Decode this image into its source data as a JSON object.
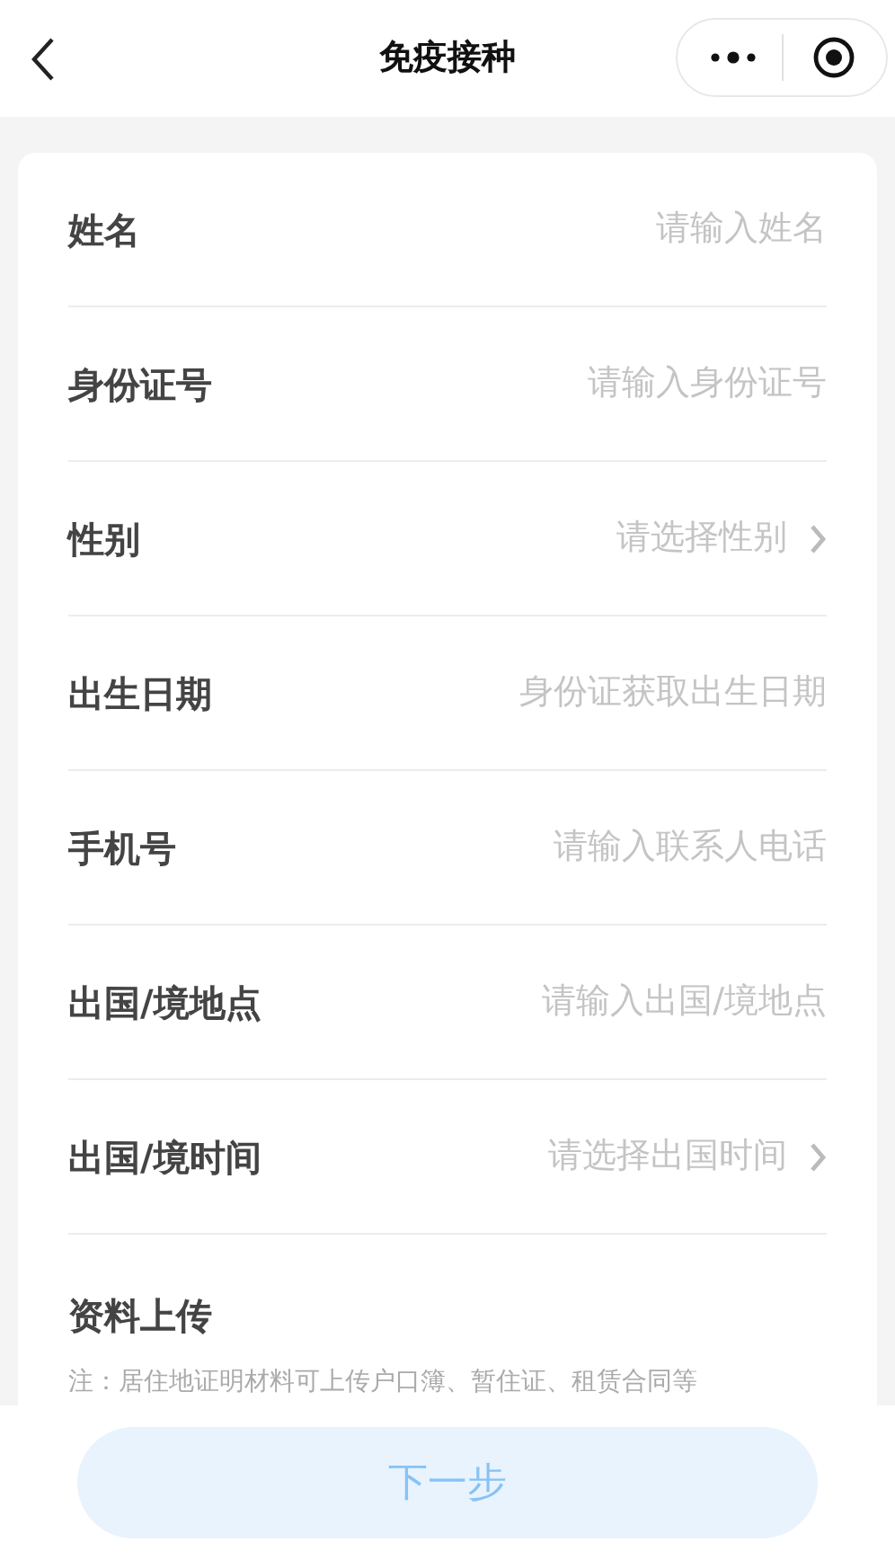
{
  "header": {
    "title": "免疫接种"
  },
  "fields": [
    {
      "label": "姓名",
      "kind": "input",
      "placeholder": "请输入姓名"
    },
    {
      "label": "身份证号",
      "kind": "input",
      "placeholder": "请输入身份证号"
    },
    {
      "label": "性别",
      "kind": "select",
      "placeholder": "请选择性别"
    },
    {
      "label": "出生日期",
      "kind": "input",
      "placeholder": "身份证获取出生日期"
    },
    {
      "label": "手机号",
      "kind": "input",
      "placeholder": "请输入联系人电话"
    },
    {
      "label": "出国/境地点",
      "kind": "input",
      "placeholder": "请输入出国/境地点"
    },
    {
      "label": "出国/境时间",
      "kind": "select",
      "placeholder": "请选择出国时间"
    }
  ],
  "upload": {
    "label": "资料上传",
    "note": "注：居住地证明材料可上传户口簿、暂住证、租赁合同等"
  },
  "next_button": "下一步"
}
